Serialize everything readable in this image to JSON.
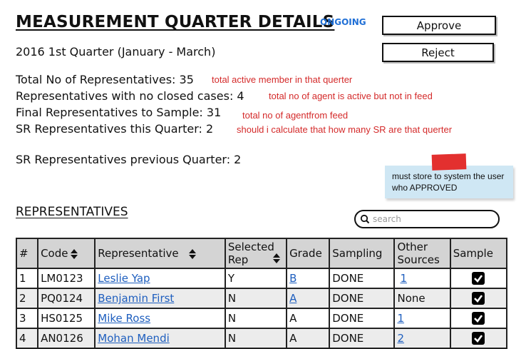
{
  "page": {
    "title": "MEASUREMENT QUARTER DETAILS",
    "status": "ONGOING",
    "quarter": "2016 1st Quarter (January - March)"
  },
  "actions": {
    "approve_label": "Approve",
    "reject_label": "Reject"
  },
  "stats": [
    {
      "label": "Total No of Representatives: 35",
      "note": "total active member in that querter"
    },
    {
      "label": "Representatives with no closed cases: 4",
      "note": "total no of agent is active but not in feed"
    },
    {
      "label": "Final Representatives to Sample: 31",
      "note": "total no of agentfrom feed"
    },
    {
      "label": "SR Representatives this Quarter: 2",
      "note": "should i calculate that how many SR are that querter"
    }
  ],
  "previous_sr": "SR Representatives previous Quarter: 2",
  "sticky_note": "must store to system the user who APPROVED",
  "section_title": "REPRESENTATIVES",
  "search": {
    "placeholder": "search"
  },
  "table": {
    "headers": {
      "num": "#",
      "code": "Code",
      "representative": "Representative",
      "selected_rep": "Selected Rep",
      "grade": "Grade",
      "sampling": "Sampling",
      "other_sources": "Other Sources",
      "sample": "Sample"
    },
    "rows": [
      {
        "num": "1",
        "code": "LM0123",
        "name": "Leslie Yap",
        "selected": "Y",
        "grade": "B",
        "sampling": "DONE",
        "other": "1"
      },
      {
        "num": "2",
        "code": "PQ0124",
        "name": "Benjamin First",
        "selected": "N",
        "grade": "A",
        "sampling": "DONE",
        "other": "None"
      },
      {
        "num": "3",
        "code": "HS0125",
        "name": "Mike Ross",
        "selected": "N",
        "grade": "A",
        "sampling": "DONE",
        "other": "1"
      },
      {
        "num": "4",
        "code": "AN0126",
        "name": "Mohan Mendi",
        "selected": "N",
        "grade": "A",
        "sampling": "DONE",
        "other": "2"
      }
    ]
  },
  "colors": {
    "accent": "#1f6fd6",
    "note_red": "#d42a2a",
    "sticky_bg": "#cfe7f4",
    "header_bg": "#d4d4d4"
  }
}
